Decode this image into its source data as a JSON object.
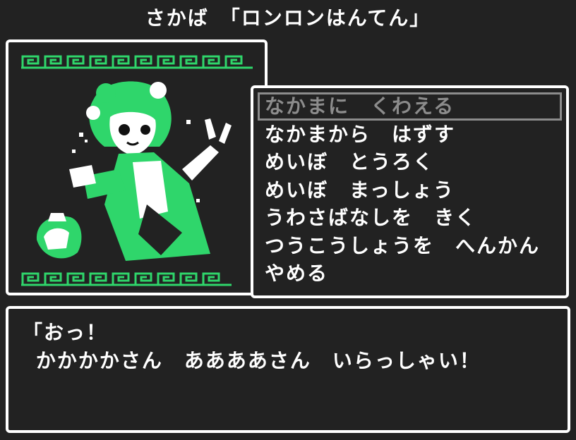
{
  "header": {
    "title": "さかば　「ロンロンはんてん」"
  },
  "colors": {
    "accent": "#2fd66b",
    "panel_bg": "#222222",
    "text": "#ffffff",
    "selected": "#8c8c8c"
  },
  "menu": {
    "items": [
      {
        "label": "なかまに　くわえる",
        "selected": true
      },
      {
        "label": "なかまから　はずす",
        "selected": false
      },
      {
        "label": "めいぼ　とうろく",
        "selected": false
      },
      {
        "label": "めいぼ　まっしょう",
        "selected": false
      },
      {
        "label": "うわさばなしを　きく",
        "selected": false
      },
      {
        "label": "つうこうしょうを　へんかん",
        "selected": false
      },
      {
        "label": "やめる",
        "selected": false
      }
    ]
  },
  "dialog": {
    "line1": "「おっ！",
    "line2": " かかかかさん　ああああさん　いらっしゃい！"
  },
  "portrait": {
    "icon": "character-portrait-icon"
  }
}
